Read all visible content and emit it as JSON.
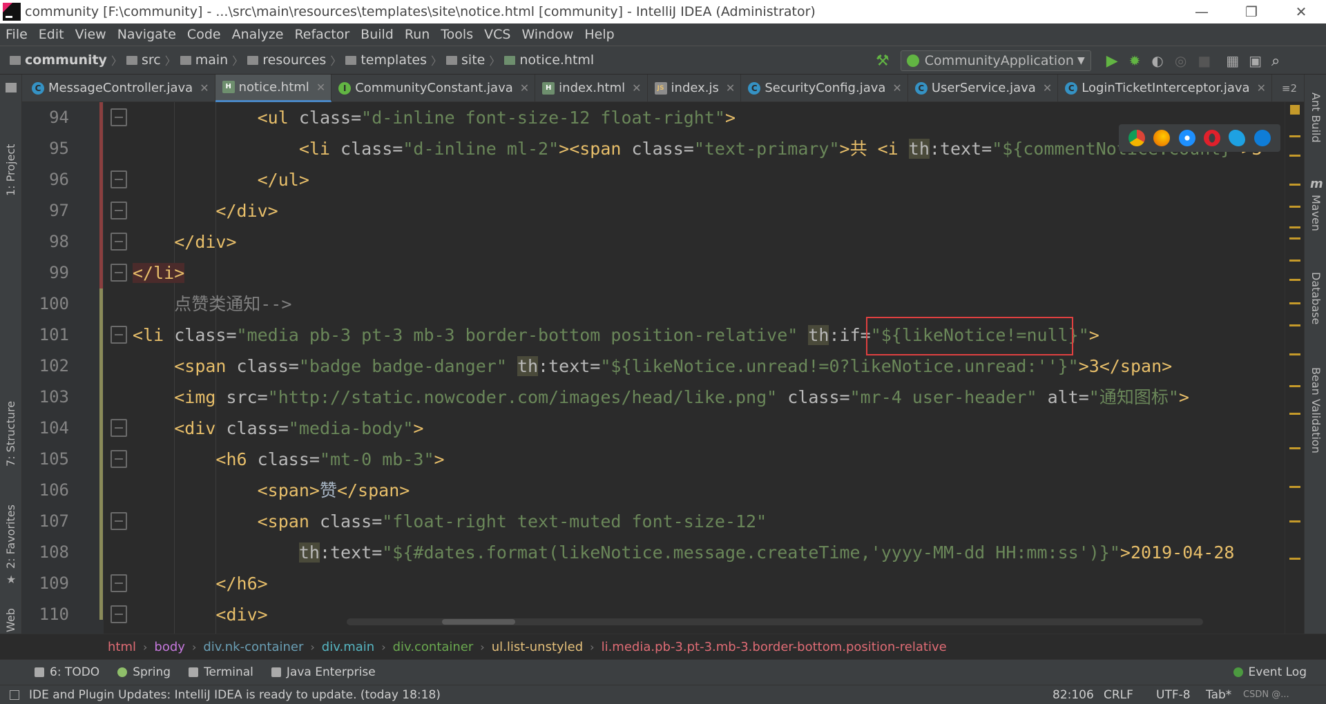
{
  "window": {
    "title": "community [F:\\community] - ...\\src\\main\\resources\\templates\\site\\notice.html [community] - IntelliJ IDEA (Administrator)",
    "minimize": "—",
    "restore": "❐",
    "close": "✕"
  },
  "menu": [
    "File",
    "Edit",
    "View",
    "Navigate",
    "Code",
    "Analyze",
    "Refactor",
    "Build",
    "Run",
    "Tools",
    "VCS",
    "Window",
    "Help"
  ],
  "nav": {
    "crumbs": [
      "community",
      "src",
      "main",
      "resources",
      "templates",
      "site",
      "notice.html"
    ],
    "run_config": "CommunityApplication"
  },
  "tabs": [
    {
      "label": "MessageController.java",
      "icon": "C",
      "kind": "c",
      "active": false
    },
    {
      "label": "notice.html",
      "icon": "H",
      "kind": "h",
      "active": true
    },
    {
      "label": "CommunityConstant.java",
      "icon": "I",
      "kind": "i",
      "active": false
    },
    {
      "label": "index.html",
      "icon": "H",
      "kind": "h",
      "active": false
    },
    {
      "label": "index.js",
      "icon": "JS",
      "kind": "js",
      "active": false
    },
    {
      "label": "SecurityConfig.java",
      "icon": "C",
      "kind": "c",
      "active": false
    },
    {
      "label": "UserService.java",
      "icon": "C",
      "kind": "c",
      "active": false
    },
    {
      "label": "LoginTicketInterceptor.java",
      "icon": "C",
      "kind": "c",
      "active": false
    }
  ],
  "tab_overflow": "≡2",
  "left_tools": [
    "1: Project",
    "7: Structure",
    "2: Favorites",
    "Web"
  ],
  "right_tools": [
    "Ant Build",
    "Maven",
    "Database",
    "Bean Validation"
  ],
  "line_numbers": [
    "94",
    "95",
    "96",
    "97",
    "98",
    "99",
    "100",
    "101",
    "102",
    "103",
    "104",
    "105",
    "106",
    "107",
    "108",
    "109",
    "110"
  ],
  "editor": {
    "l94": {
      "ws": "            ",
      "open": "<ul ",
      "a1": "class=",
      "v1": "\"d-inline font-size-12 float-right\"",
      "close": ">"
    },
    "l95": {
      "ws": "                ",
      "p1": "<li ",
      "a1": "class=",
      "v1": "\"d-inline ml-2\"",
      "p2": "><span ",
      "a2": "class=",
      "v2": "\"text-primary\"",
      "p3": ">共 <i ",
      "th": "th",
      "a3": ":text=",
      "v3": "\"${commentNotice.count}\"",
      "tail": ">3"
    },
    "l96": {
      "ws": "            ",
      "t": "</ul>"
    },
    "l97": {
      "ws": "        ",
      "t": "</div>"
    },
    "l98": {
      "ws": "    ",
      "t": "</div>"
    },
    "l99": {
      "ws": "",
      "t": "</li>"
    },
    "l100": {
      "ws": "    ",
      "t": "点赞类通知-->"
    },
    "l101": {
      "ws": "",
      "p1": "<li ",
      "a1": "class=",
      "v1": "\"media pb-3 pt-3 mb-3 border-bottom position-relative\"",
      "sp": " ",
      "th": "th",
      "a2": ":if=",
      "v2": "\"${likeNotice!=null}\"",
      "close": ">"
    },
    "l102": {
      "ws": "    ",
      "p1": "<span ",
      "a1": "class=",
      "v1": "\"badge badge-danger\"",
      "sp": " ",
      "th": "th",
      "a2": ":text=",
      "v2": "\"${likeNotice.unread!=0?likeNotice.unread:''}\"",
      "tail": ">3</span>"
    },
    "l103": {
      "ws": "    ",
      "p1": "<img ",
      "a1": "src=",
      "v1": "\"http://static.nowcoder.com/images/head/like.png\"",
      "a2": " class=",
      "v2": "\"mr-4 user-header\"",
      "a3": " alt=",
      "v3": "\"通知图标\"",
      "close": ">"
    },
    "l104": {
      "ws": "    ",
      "p1": "<div ",
      "a1": "class=",
      "v1": "\"media-body\"",
      "close": ">"
    },
    "l105": {
      "ws": "        ",
      "p1": "<h6 ",
      "a1": "class=",
      "v1": "\"mt-0 mb-3\"",
      "close": ">"
    },
    "l106": {
      "ws": "            ",
      "p1": "<span>",
      "txt": "赞",
      "p2": "</span>"
    },
    "l107": {
      "ws": "            ",
      "p1": "<span ",
      "a1": "class=",
      "v1": "\"float-right text-muted font-size-12\""
    },
    "l108": {
      "ws": "                ",
      "th": "th",
      "a1": ":text=",
      "v1": "\"${#dates.format(likeNotice.message.createTime,'yyyy-MM-dd HH:mm:ss')}\"",
      "tail": ">2019-04-28"
    },
    "l109": {
      "ws": "        ",
      "t": "</h6>"
    },
    "l110": {
      "ws": "        ",
      "t": "<div>"
    }
  },
  "breadcrumb": [
    {
      "label": "html",
      "color": "#e06c75"
    },
    {
      "label": "body",
      "color": "#c678dd"
    },
    {
      "label": "div.nk-container",
      "color": "#6a9fb5"
    },
    {
      "label": "div.main",
      "color": "#56b6c2"
    },
    {
      "label": "div.container",
      "color": "#6aa84f"
    },
    {
      "label": "ul.list-unstyled",
      "color": "#e5c07b"
    },
    {
      "label": "li.media.pb-3.pt-3.mb-3.border-bottom.position-relative",
      "color": "#e06c75"
    }
  ],
  "bottom_tools": [
    "6: TODO",
    "Spring",
    "Terminal",
    "Java Enterprise"
  ],
  "event_log": "Event Log",
  "status": {
    "message": "IDE and Plugin Updates: IntelliJ IDEA is ready to update. (today 18:18)",
    "position": "82:106",
    "line_sep": "CRLF",
    "encoding": "UTF-8",
    "indent": "Tab*",
    "watermark": "CSDN @..."
  },
  "colors": {
    "accent": "#4a88c7",
    "highlight_box": "#e04040"
  }
}
